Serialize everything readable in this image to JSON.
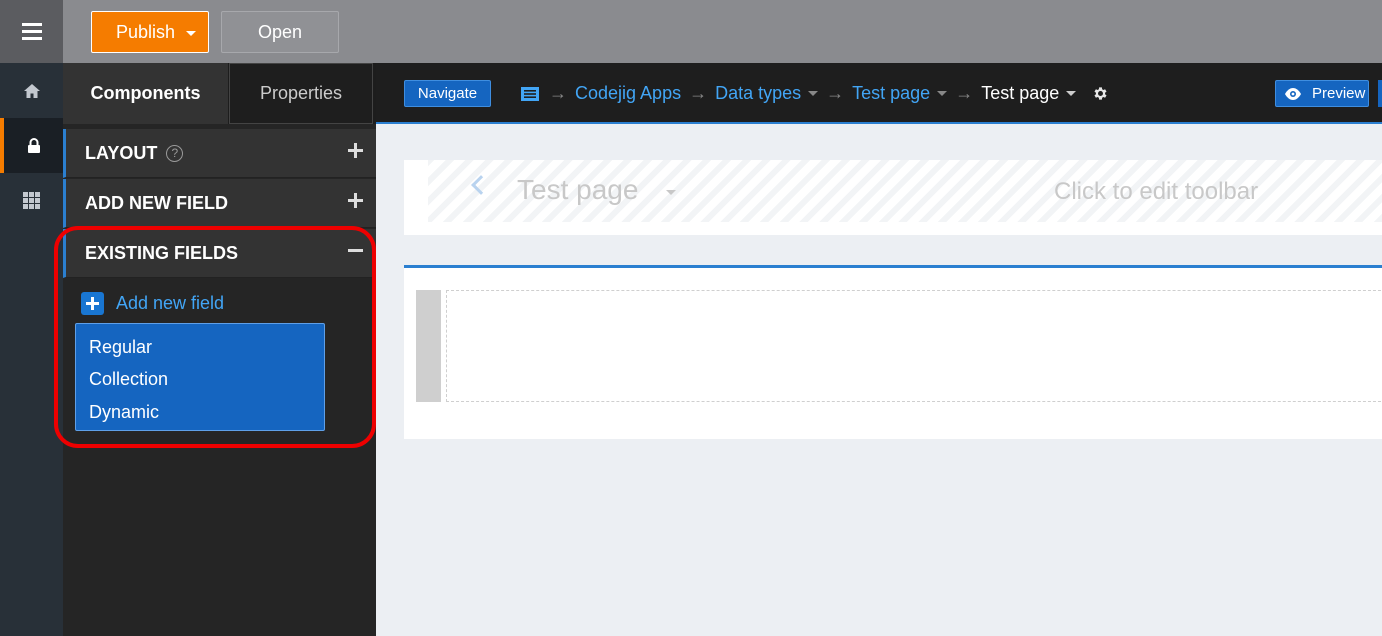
{
  "topbar": {
    "publish_label": "Publish",
    "open_label": "Open",
    "accent": "#f57c00"
  },
  "rail": {
    "items": [
      {
        "icon": "home-icon"
      },
      {
        "icon": "lock-icon",
        "active": true
      },
      {
        "icon": "grid-icon"
      }
    ]
  },
  "panel": {
    "tabs": [
      "Components",
      "Properties"
    ],
    "sections": {
      "layout": "LAYOUT",
      "add_new_field": "ADD NEW FIELD",
      "existing_fields": "EXISTING FIELDS"
    },
    "help_glyph": "?",
    "add_field_link": "Add new field",
    "dropdown_options": [
      "Regular",
      "Collection",
      "Dynamic"
    ]
  },
  "navbar": {
    "navigate_label": "Navigate",
    "breadcrumb": [
      "Codejig Apps",
      "Data types",
      "Test page",
      "Test page"
    ],
    "preview_label": "Preview"
  },
  "canvas": {
    "toolbar_title": "Test page",
    "toolbar_hint": "Click to edit toolbar"
  },
  "colors": {
    "primary": "#1565c0",
    "link": "#42a5f5",
    "highlight": "#e00000"
  }
}
